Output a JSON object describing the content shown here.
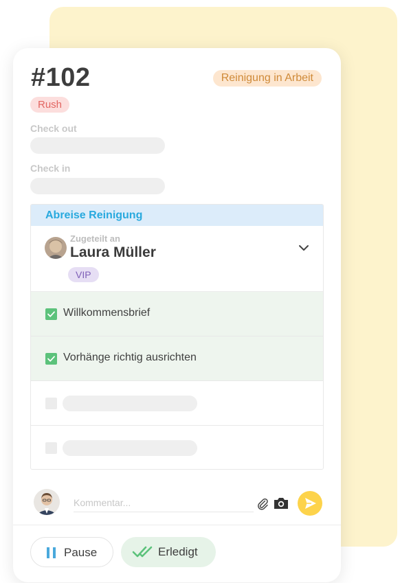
{
  "room": {
    "number": "#102",
    "status": "Reinigung in Arbeit",
    "priority": "Rush"
  },
  "fields": {
    "check_out_label": "Check out",
    "check_in_label": "Check in"
  },
  "cleaning": {
    "title": "Abreise Reinigung",
    "assigned_label": "Zugeteilt an",
    "assignee": "Laura Müller",
    "tag": "VIP",
    "tasks": [
      {
        "label": "Willkommensbrief",
        "checked": true
      },
      {
        "label": "Vorhänge richtig ausrichten",
        "checked": true
      }
    ]
  },
  "comment": {
    "placeholder": "Kommentar..."
  },
  "actions": {
    "pause_label": "Pause",
    "done_label": "Erledigt"
  },
  "icons": {
    "chevron": "chevron-down-icon",
    "checkbox": "check-icon",
    "attach": "paperclip-icon",
    "camera": "camera-icon",
    "send": "send-icon",
    "pause": "pause-icon",
    "done": "double-check-icon"
  },
  "colors": {
    "status_bg": "#fde6cf",
    "status_text": "#cf8a38",
    "rush_bg": "#fcdedd",
    "rush_text": "#e26561",
    "section_head_bg": "#dcecfa",
    "section_head_text": "#28a9de",
    "vip_bg": "#e6def4",
    "vip_text": "#7e5fb7",
    "check_green": "#5cc27b",
    "send_yellow": "#fdd34b",
    "pause_blue": "#4aa9dc"
  }
}
